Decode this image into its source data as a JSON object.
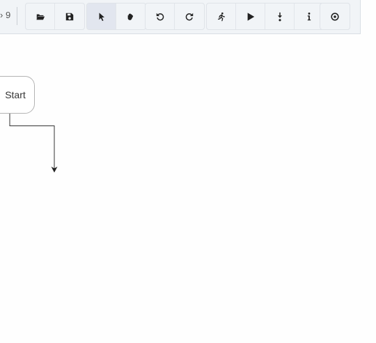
{
  "toolbar": {
    "counter_text": "› 9",
    "groups": [
      [
        {
          "icon": "folder-open-icon"
        },
        {
          "icon": "save-icon"
        }
      ],
      [
        {
          "icon": "pointer-icon",
          "active": true
        },
        {
          "icon": "hand-icon"
        }
      ],
      [
        {
          "icon": "undo-icon"
        },
        {
          "icon": "redo-icon"
        }
      ],
      [
        {
          "icon": "run-icon"
        },
        {
          "icon": "play-icon"
        },
        {
          "icon": "step-into-icon"
        },
        {
          "icon": "info-icon"
        }
      ],
      [
        {
          "icon": "settings-icon"
        }
      ]
    ]
  },
  "canvas": {
    "start_node_label": "Start"
  }
}
